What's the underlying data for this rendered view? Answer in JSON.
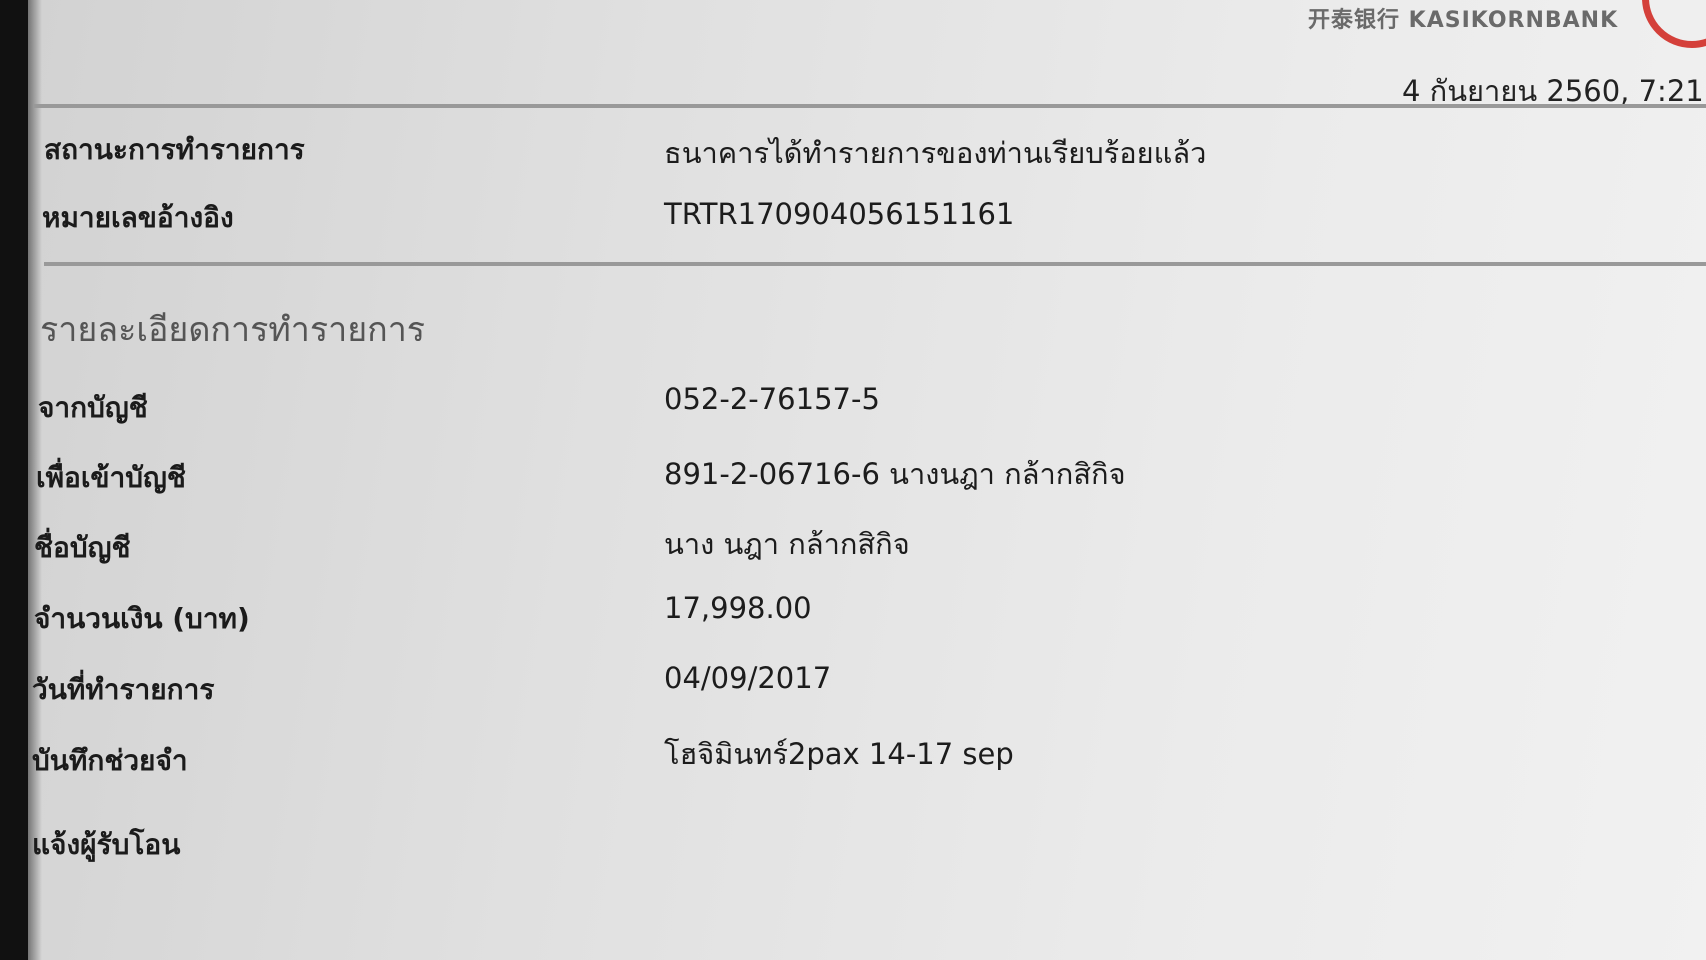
{
  "header": {
    "bank_name": "开泰银行 KASIKORNBANK",
    "timestamp": "4 กันยายน 2560, 7:21"
  },
  "status": {
    "label": "สถานะการทำรายการ",
    "value": "ธนาคารได้ทำรายการของท่านเรียบร้อยแล้ว"
  },
  "reference": {
    "label": "หมายเลขอ้างอิง",
    "value": "TRTR170904056151161"
  },
  "details": {
    "title": "รายละเอียดการทำรายการ",
    "from_account": {
      "label": "จากบัญชี",
      "value": "052-2-76157-5"
    },
    "to_account": {
      "label": "เพื่อเข้าบัญชี",
      "value": "891-2-06716-6 นางนฎา กล้ากสิกิจ"
    },
    "account_name": {
      "label": "ชื่อบัญชี",
      "value": "นาง นฎา กล้ากสิกิจ"
    },
    "amount": {
      "label": "จำนวนเงิน (บาท)",
      "value": "17,998.00"
    },
    "date": {
      "label": "วันที่ทำรายการ",
      "value": "04/09/2017"
    },
    "memo": {
      "label": "บันทึกช่วยจำ",
      "value": "โฮจิมินทร์2pax 14-17 sep"
    },
    "notify": {
      "label": "แจ้งผู้รับโอน",
      "value": ""
    }
  },
  "colors": {
    "logo_accent": "#d4403a"
  }
}
